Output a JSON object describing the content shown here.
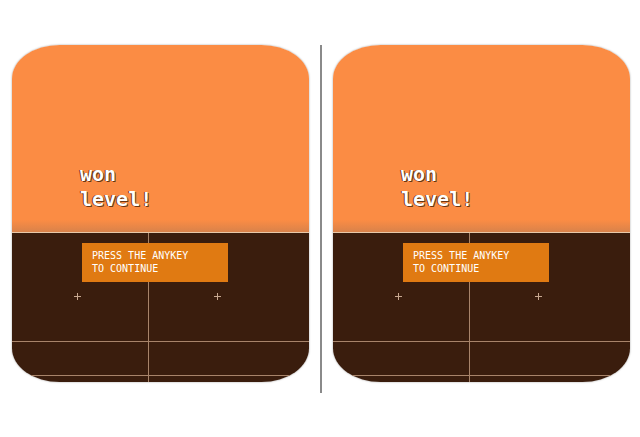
{
  "message": {
    "title_lines": [
      "won",
      "level!"
    ],
    "prompt_lines": [
      "PRESS THE ANYKEY",
      "TO CONTINUE"
    ]
  },
  "views": [
    {
      "kind": "left"
    },
    {
      "kind": "right"
    }
  ]
}
